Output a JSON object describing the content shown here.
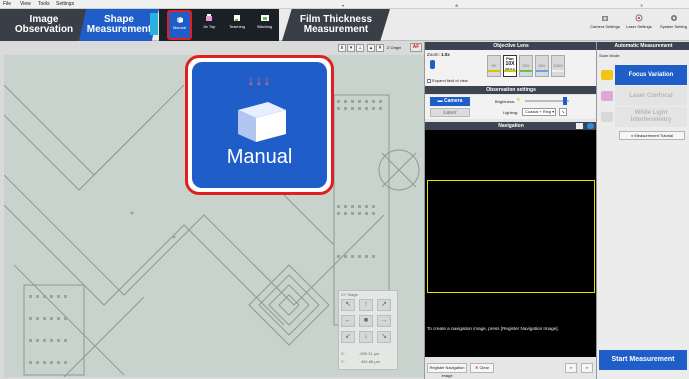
{
  "menu": [
    "File",
    "View",
    "Tools",
    "Settings"
  ],
  "tabs": {
    "image_observation": [
      "Image",
      "Observation"
    ],
    "shape_measurement": [
      "Shape",
      "Measurement"
    ],
    "film_thickness": [
      "Film Thickness",
      "Measurement"
    ]
  },
  "ribbon": {
    "manual": "Manual",
    "jin_top": "Jin Top",
    "teaching": "Teaching",
    "stitching": "Stitching",
    "camera_settings": "Camera Settings",
    "laser_settings": "Laser Settings",
    "system_settings": "System Setting"
  },
  "viewtool": {
    "origin": "Z Origin",
    "af": "AF"
  },
  "callout": {
    "title": "Manual"
  },
  "objective": {
    "header": "Objective Lens",
    "zoom_label": "Zoom:",
    "zoom_value": "1.0x",
    "expand": "Expand field of view",
    "lenses": [
      {
        "label": "5X",
        "selected": false
      },
      {
        "label": "10X",
        "selected": true,
        "top": "Plan",
        "sub": "NA 0.3"
      },
      {
        "label": "20X",
        "selected": false
      },
      {
        "label": "50X",
        "selected": false
      },
      {
        "label": "100X",
        "selected": false
      }
    ]
  },
  "observation": {
    "header": "Observation settings",
    "camera": "Camera",
    "laser": "Laser",
    "brightness": "Brightness:",
    "lighting": "Lighting:",
    "lighting_value": "Coaxial + Ring"
  },
  "navigation": {
    "header": "Navigation",
    "message": "To create a navigation image, press [Register Navigation Image].",
    "register": "Register Navigation Image",
    "clear": "Clear"
  },
  "auto": {
    "header": "Automatic Measurement",
    "scan_mode": "Scan Mode:",
    "modes": [
      {
        "label": "Focus Variation",
        "active": true,
        "icon_color": "#f2c418"
      },
      {
        "label": "Laser Confocal",
        "active": false,
        "icon_color": "#e0a8d8"
      },
      {
        "label": "White Light Interferometry",
        "active": false,
        "icon_color": "#d8d8d8"
      }
    ],
    "tutorial": "Measurement Tutorial",
    "start": "Start Measurement"
  },
  "stage": {
    "header": "XY Stage",
    "x_label": "X :",
    "x_value": "-559.31",
    "y_label": "Y :",
    "y_value": "454.88",
    "unit": "μm"
  }
}
